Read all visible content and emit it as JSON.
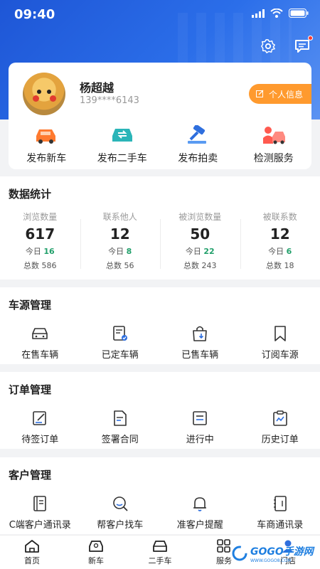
{
  "status_bar": {
    "time": "09:40"
  },
  "header": {
    "icons": [
      "settings-icon",
      "message-icon"
    ]
  },
  "profile": {
    "name": "杨超越",
    "phone": "139****6143",
    "info_button": "个人信息"
  },
  "quick_actions": [
    {
      "label": "发布新车",
      "icon": "new-car-icon"
    },
    {
      "label": "发布二手车",
      "icon": "used-car-icon"
    },
    {
      "label": "发布拍卖",
      "icon": "auction-hammer-icon"
    },
    {
      "label": "检测服务",
      "icon": "inspection-icon"
    }
  ],
  "stats": {
    "title": "数据统计",
    "today_label": "今日",
    "total_label": "总数",
    "items": [
      {
        "label": "浏览数量",
        "value": "617",
        "today": "16",
        "total": "586"
      },
      {
        "label": "联系他人",
        "value": "12",
        "today": "8",
        "total": "56"
      },
      {
        "label": "被浏览数量",
        "value": "50",
        "today": "22",
        "total": "243"
      },
      {
        "label": "被联系数",
        "value": "12",
        "today": "6",
        "total": "18"
      }
    ]
  },
  "inventory": {
    "title": "车源管理",
    "items": [
      {
        "label": "在售车辆",
        "icon": "car-front-icon"
      },
      {
        "label": "已定车辆",
        "icon": "reserved-doc-icon"
      },
      {
        "label": "已售车辆",
        "icon": "sold-bag-icon"
      },
      {
        "label": "订阅车源",
        "icon": "bookmark-icon"
      }
    ]
  },
  "orders": {
    "title": "订单管理",
    "items": [
      {
        "label": "待签订单",
        "icon": "pending-sign-icon"
      },
      {
        "label": "签署合同",
        "icon": "contract-icon"
      },
      {
        "label": "进行中",
        "icon": "in-progress-icon"
      },
      {
        "label": "历史订单",
        "icon": "history-order-icon"
      }
    ]
  },
  "customers": {
    "title": "客户管理",
    "items": [
      {
        "label": "C端客户通讯录",
        "icon": "address-book-icon"
      },
      {
        "label": "帮客户找车",
        "icon": "search-car-icon"
      },
      {
        "label": "准客户提醒",
        "icon": "bell-icon"
      },
      {
        "label": "车商通讯录",
        "icon": "dealer-book-icon"
      }
    ]
  },
  "tabbar": [
    {
      "label": "首页",
      "icon": "home-icon"
    },
    {
      "label": "新车",
      "icon": "new-car-tab-icon"
    },
    {
      "label": "二手车",
      "icon": "used-car-tab-icon"
    },
    {
      "label": "服务",
      "icon": "service-grid-icon"
    },
    {
      "label": "门店",
      "icon": "store-person-icon"
    }
  ],
  "watermark": {
    "text": "GOGO手游网",
    "sub": "WWW.GOGO8.COM"
  },
  "colors": {
    "primary": "#2b6ee9",
    "accent": "#ff9a2e",
    "positive": "#22a06b"
  }
}
